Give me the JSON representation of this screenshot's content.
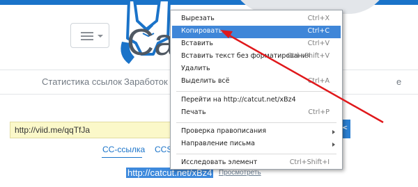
{
  "site": {
    "logo_text": "Catcut"
  },
  "nav": {
    "items": [
      {
        "label": "Статистика ссылок"
      },
      {
        "label": "Заработок н"
      },
      {
        "label": "е"
      }
    ]
  },
  "shortener": {
    "input_value": "http://viid.me/qqTfJa",
    "cut_icon": "scissors-icon",
    "tabs": [
      {
        "label": "CC-ссылка"
      },
      {
        "label": "CCS"
      }
    ],
    "short_link": "http://catcut.net/xBz4",
    "preview_label": "Просмотреть"
  },
  "context_menu": {
    "items": [
      {
        "label": "Вырезать",
        "shortcut": "Ctrl+X"
      },
      {
        "label": "Копировать",
        "shortcut": "Ctrl+C",
        "active": true
      },
      {
        "label": "Вставить",
        "shortcut": "Ctrl+V"
      },
      {
        "label": "Вставить текст без форматирования",
        "shortcut": "Ctrl+Shift+V"
      },
      {
        "label": "Удалить",
        "shortcut": ""
      },
      {
        "label": "Выделить всё",
        "shortcut": "Ctrl+A"
      },
      {
        "label": "Перейти на http://catcut.net/xBz4",
        "shortcut": ""
      },
      {
        "label": "Печать",
        "shortcut": "Ctrl+P"
      },
      {
        "label": "Проверка правописания",
        "shortcut": "",
        "submenu": true
      },
      {
        "label": "Направление письма",
        "shortcut": "",
        "submenu": true
      },
      {
        "label": "Исследовать элемент",
        "shortcut": "Ctrl+Shift+I"
      }
    ]
  },
  "colors": {
    "accent": "#1a73c9",
    "menu_highlight": "#3f86d8",
    "annotation_arrow": "#e0181b",
    "input_bg": "#fbf8c9"
  }
}
